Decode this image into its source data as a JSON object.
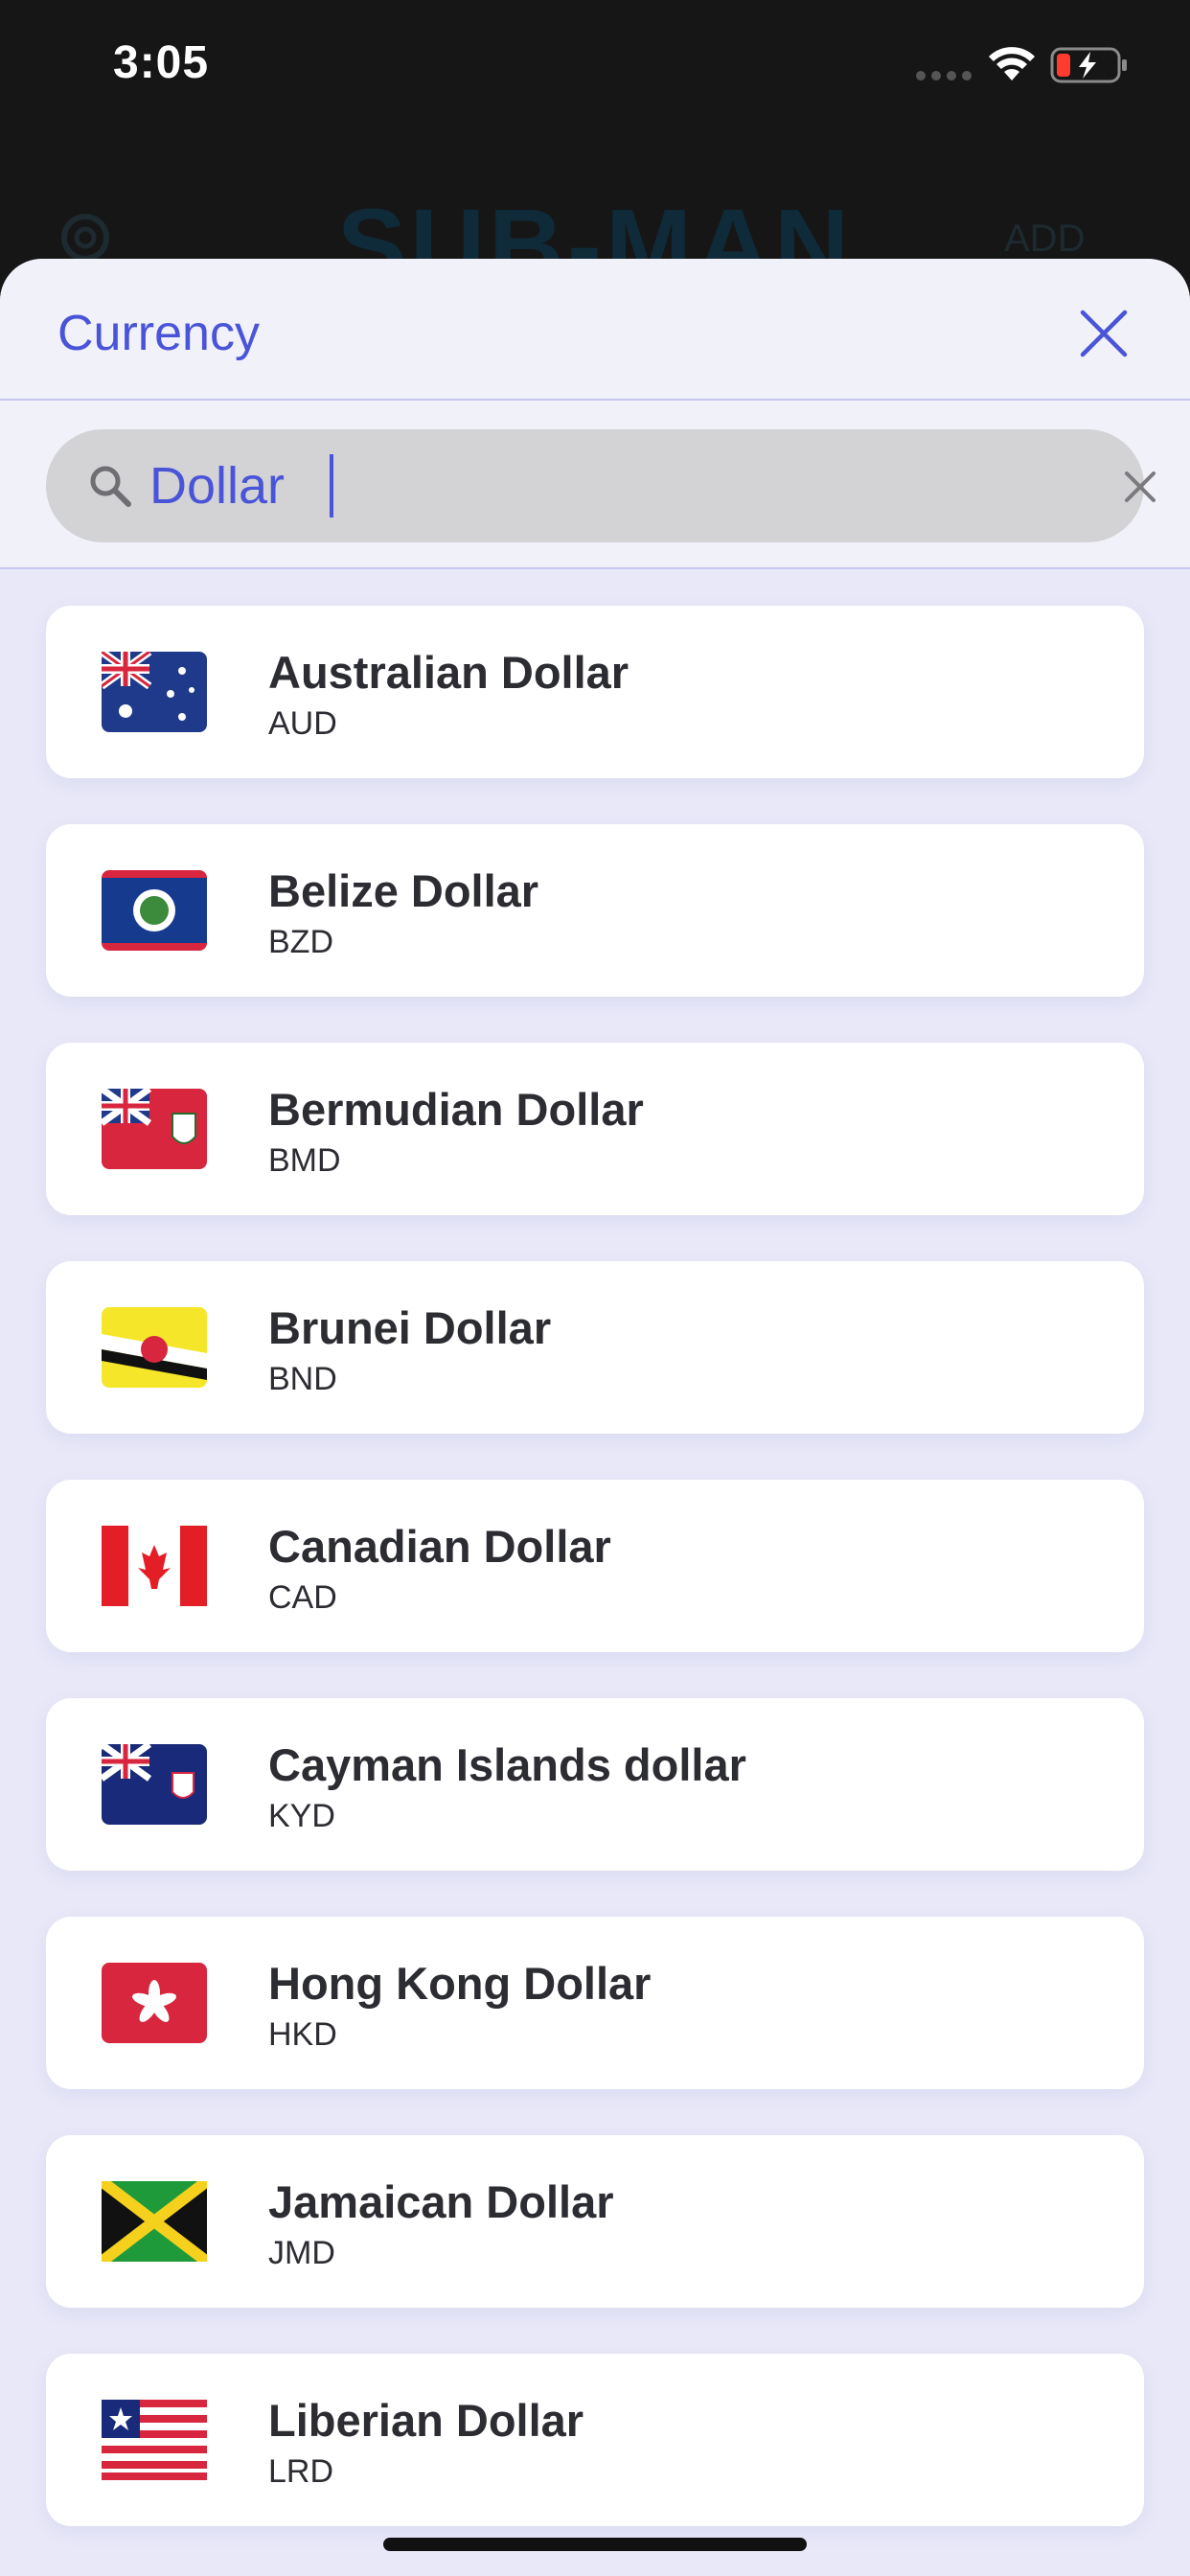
{
  "status_bar": {
    "time": "3:05",
    "icons": [
      "signal-icon",
      "wifi-icon",
      "battery-charging-icon"
    ]
  },
  "background_header": {
    "title": "SUB-MAN",
    "add_label": "ADD",
    "icons": [
      "gear-icon"
    ]
  },
  "sheet": {
    "title": "Currency",
    "close_icon": "close-icon",
    "search": {
      "value": "Dollar",
      "icon": "search-icon",
      "clear_icon": "clear-icon"
    }
  },
  "currencies": [
    {
      "name": "Australian Dollar",
      "code": "AUD",
      "flag": "flag-australia"
    },
    {
      "name": "Belize Dollar",
      "code": "BZD",
      "flag": "flag-belize"
    },
    {
      "name": "Bermudian Dollar",
      "code": "BMD",
      "flag": "flag-bermuda"
    },
    {
      "name": "Brunei Dollar",
      "code": "BND",
      "flag": "flag-brunei"
    },
    {
      "name": "Canadian Dollar",
      "code": "CAD",
      "flag": "flag-canada"
    },
    {
      "name": "Cayman Islands dollar",
      "code": "KYD",
      "flag": "flag-cayman-islands"
    },
    {
      "name": "Hong Kong Dollar",
      "code": "HKD",
      "flag": "flag-hong-kong"
    },
    {
      "name": "Jamaican Dollar",
      "code": "JMD",
      "flag": "flag-jamaica"
    },
    {
      "name": "Liberian Dollar",
      "code": "LRD",
      "flag": "flag-liberia"
    }
  ],
  "colors": {
    "accent": "#4a54d8",
    "sheet_bg": "#e8e8f8",
    "card_bg": "#ffffff",
    "text": "#2c2c33"
  }
}
